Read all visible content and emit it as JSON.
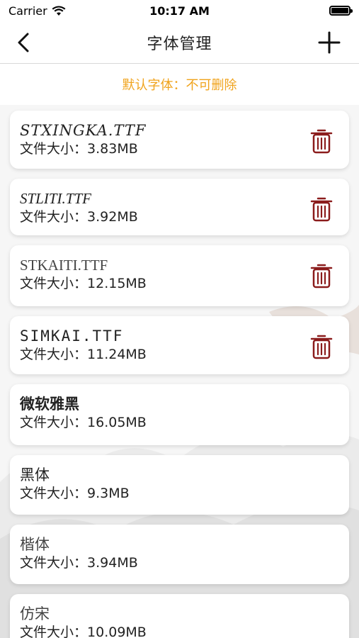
{
  "status_bar": {
    "carrier": "Carrier",
    "time": "10:17 AM"
  },
  "nav": {
    "title": "字体管理",
    "back_icon": "chevron-left-icon",
    "add_icon": "plus-icon"
  },
  "notice": "默认字体：不可删除",
  "size_prefix": "文件大小：",
  "colors": {
    "accent": "#f0a31c",
    "delete": "#8b1c1c"
  },
  "fonts": [
    {
      "name": "STXINGKA.TTF",
      "size": "3.83MB",
      "deletable": true
    },
    {
      "name": "STLITI.TTF",
      "size": "3.92MB",
      "deletable": true
    },
    {
      "name": "STKAITI.TTF",
      "size": "12.15MB",
      "deletable": true
    },
    {
      "name": "SIMKAI.TTF",
      "size": "11.24MB",
      "deletable": true
    },
    {
      "name": "微软雅黑",
      "size": "16.05MB",
      "deletable": false
    },
    {
      "name": "黑体",
      "size": "9.3MB",
      "deletable": false
    },
    {
      "name": "楷体",
      "size": "3.94MB",
      "deletable": false
    },
    {
      "name": "仿宋",
      "size": "10.09MB",
      "deletable": false
    }
  ]
}
